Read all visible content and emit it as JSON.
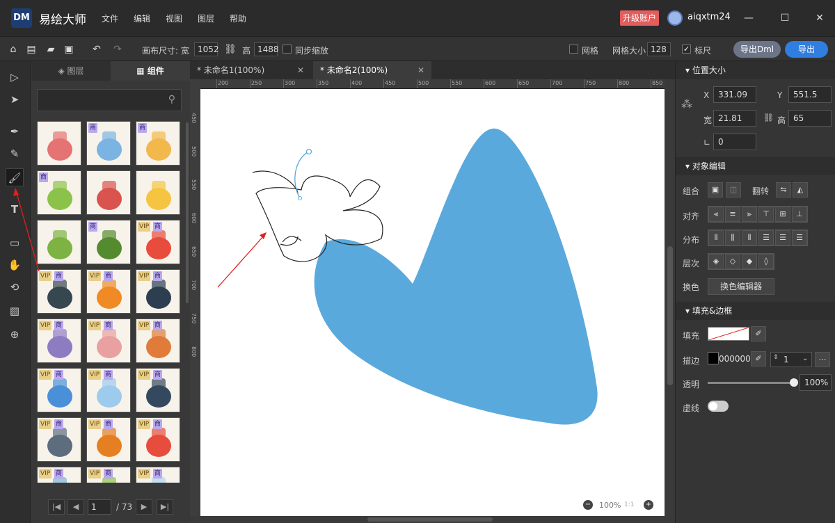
{
  "app": {
    "logo": "DM",
    "name": "易绘大师",
    "menus": [
      "文件",
      "编辑",
      "视图",
      "图层",
      "帮助"
    ],
    "upgrade_label": "升级账户",
    "username": "aiqxtm24"
  },
  "toolbar": {
    "canvas_size_label": "画布尺寸: 宽",
    "width_value": "1052",
    "height_label": "高",
    "height_value": "1488",
    "sync_scale_label": "同步缩放",
    "grid_label": "网格",
    "grid_size_label": "网格大小",
    "grid_size_value": "128",
    "ruler_label": "标尺",
    "export_dml_label": "导出Dml",
    "export_label": "导出"
  },
  "left_panel": {
    "tab_layers": "图层",
    "tab_components": "组件",
    "search_placeholder": "",
    "tiles": [
      {
        "icon": "dancer-illustration",
        "vip": false,
        "biz": false
      },
      {
        "icon": "man-presenting-illustration",
        "vip": false,
        "biz": true
      },
      {
        "icon": "man-standing-illustration",
        "vip": false,
        "biz": true
      },
      {
        "icon": "woman-meditating-illustration",
        "vip": false,
        "biz": true
      },
      {
        "icon": "tomatoes-illustration",
        "vip": false,
        "biz": false
      },
      {
        "icon": "school-bus-illustration",
        "vip": false,
        "biz": false
      },
      {
        "icon": "cactus-pot-illustration",
        "vip": false,
        "biz": false
      },
      {
        "icon": "bamboo-plant-illustration",
        "vip": false,
        "biz": true
      },
      {
        "icon": "shopping-cart-illustration",
        "vip": true,
        "biz": true
      },
      {
        "icon": "remote-control-illustration",
        "vip": true,
        "biz": true
      },
      {
        "icon": "alarm-clock-illustration",
        "vip": true,
        "biz": true
      },
      {
        "icon": "digital-clock-illustration",
        "vip": true,
        "biz": true
      },
      {
        "icon": "round-mirror-illustration",
        "vip": true,
        "biz": true
      },
      {
        "icon": "towel-illustration",
        "vip": true,
        "biz": true
      },
      {
        "icon": "basketball-illustration",
        "vip": true,
        "biz": true
      },
      {
        "icon": "brush-cup-illustration",
        "vip": true,
        "biz": true
      },
      {
        "icon": "window-illustration",
        "vip": true,
        "biz": true
      },
      {
        "icon": "dark-window-illustration",
        "vip": true,
        "biz": true
      },
      {
        "icon": "air-conditioner-illustration",
        "vip": true,
        "biz": true
      },
      {
        "icon": "wooden-window-illustration",
        "vip": true,
        "biz": true
      },
      {
        "icon": "gift-box-illustration",
        "vip": true,
        "biz": true
      },
      {
        "icon": "bathtub-illustration",
        "vip": true,
        "biz": true
      },
      {
        "icon": "planter-illustration",
        "vip": true,
        "biz": true
      },
      {
        "icon": "glass-panel-illustration",
        "vip": true,
        "biz": true
      }
    ],
    "badge_vip": "VIP",
    "badge_biz": "商",
    "page_current": "1",
    "page_total": "/ 73"
  },
  "doc_tabs": [
    {
      "label": "* 未命名1(100%)",
      "active": false
    },
    {
      "label": "* 未命名2(100%)",
      "active": true
    }
  ],
  "rulers": {
    "h_ticks": [
      "200",
      "250",
      "300",
      "350",
      "400",
      "450",
      "500",
      "550",
      "600",
      "650",
      "700",
      "750",
      "800",
      "850"
    ],
    "v_ticks": [
      "450",
      "500",
      "550",
      "600",
      "650",
      "700",
      "750",
      "800"
    ]
  },
  "canvas": {
    "zoom_level": "100%",
    "zoom_ratio": "1:1",
    "shape_color": "#5aa9dd"
  },
  "right_panel": {
    "pos_size_title": "位置大小",
    "x_label": "X",
    "x_value": "331.09",
    "y_label": "Y",
    "y_value": "551.5",
    "w_label": "宽",
    "w_value": "21.81",
    "h_label": "高",
    "h_value": "65",
    "angle_value": "0",
    "object_edit_title": "对象编辑",
    "group_label": "组合",
    "flip_label": "翻转",
    "align_label": "对齐",
    "distribute_label": "分布",
    "layer_label": "层次",
    "recolor_label": "换色",
    "color_editor_label": "换色编辑器",
    "fill_stroke_title": "填充&边框",
    "fill_label": "填充",
    "stroke_label": "描边",
    "stroke_color": "000000",
    "stroke_width": "1",
    "opacity_label": "透明",
    "opacity_value": "100%",
    "dash_label": "虚线"
  }
}
